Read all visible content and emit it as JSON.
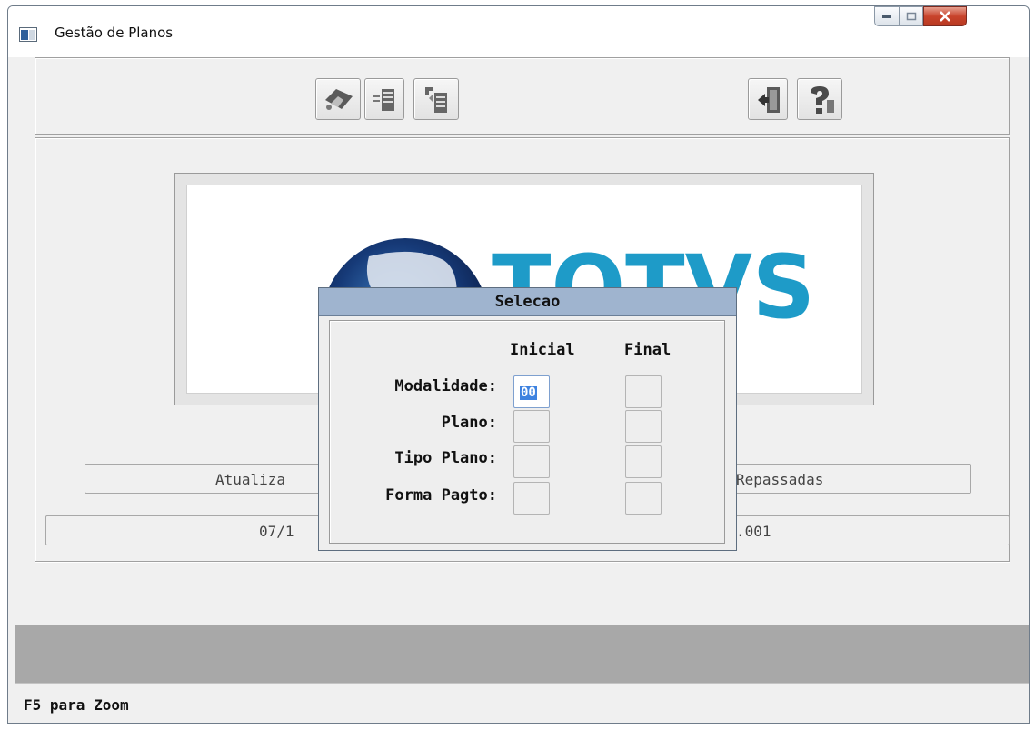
{
  "window": {
    "title": "Gestão de Planos",
    "controls": [
      "minimize-icon",
      "maximize-icon",
      "close-icon"
    ]
  },
  "toolbar": {
    "buttons": [
      "wizard-icon",
      "list-icon",
      "copy-icon",
      "exit-icon",
      "help-icon"
    ]
  },
  "logo": {
    "text": "TOTVS",
    "color": "#1e9bc8"
  },
  "fields": {
    "atualiza_left": "Atualiza",
    "atualiza_right": "Repassadas",
    "date_left": "07/1",
    "date_right": ".001"
  },
  "dialog": {
    "title": "Selecao",
    "col_inicial": "Inicial",
    "col_final": "Final",
    "rows": [
      {
        "label": "Modalidade:",
        "inicial": "00",
        "final": ""
      },
      {
        "label": "Plano:",
        "inicial": "",
        "final": ""
      },
      {
        "label": "Tipo Plano:",
        "inicial": "",
        "final": ""
      },
      {
        "label": "Forma Pagto:",
        "inicial": "",
        "final": ""
      }
    ]
  },
  "status": {
    "text": "F5 para Zoom"
  },
  "colors": {
    "title_bar": "#9fb4cf",
    "selection": "#3d82e0",
    "gray_band": "#a8a8a8"
  }
}
